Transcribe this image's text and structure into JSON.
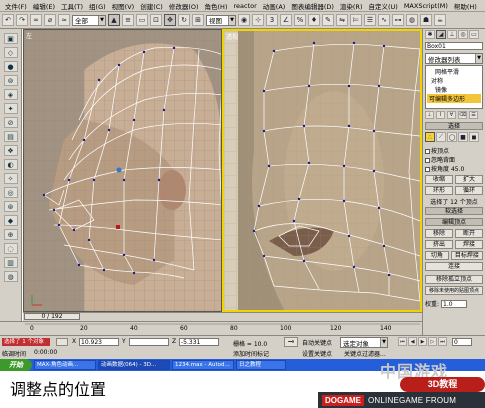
{
  "menubar": {
    "items": [
      "文件(F)",
      "编辑(E)",
      "工具(T)",
      "组(G)",
      "视图(V)",
      "创建(C)",
      "修改器(O)",
      "角色(H)",
      "reactor",
      "动画(A)",
      "图表编辑器(D)",
      "渲染(R)",
      "自定义(U)",
      "MAXScript(M)",
      "帮助(H)"
    ]
  },
  "toolbar": {
    "selection_filter": "全部",
    "view_combo": "视图"
  },
  "viewports": {
    "left_label": "左",
    "right_label": "透视"
  },
  "command_panel": {
    "object_name": "Box01",
    "modifier_list": "修改器列表",
    "stack": [
      "网格平滑",
      "对称",
      "镜像",
      "可编辑多边形"
    ],
    "select_rollout": "选择",
    "opt_by_vertex": "按顶点",
    "opt_ignore_back": "忽略背面",
    "opt_by_angle": "按角度",
    "angle_value": "45.0",
    "btn_shrink": "收缩",
    "btn_grow": "扩大",
    "btn_ring": "环形",
    "btn_loop": "循环",
    "status_selected": "选择了 12 个顶点",
    "soft_select_rollout": "软选择",
    "edit_vertices_rollout": "编辑顶点",
    "btn_remove": "移除",
    "btn_break": "断开",
    "btn_extrude": "挤出",
    "btn_weld": "焊接",
    "btn_chamfer": "切角",
    "btn_target_weld": "目标焊接",
    "btn_connect": "连接",
    "btn_remove_isolated": "移除孤立顶点",
    "btn_remove_unused_map": "移除未使用的贴图顶点",
    "weight_label": "权重:",
    "weight_value": "1.0"
  },
  "timeslider": {
    "label": "0 / 192"
  },
  "trackbar": {
    "ticks": [
      "0",
      "20",
      "40",
      "60",
      "80",
      "100",
      "120",
      "140"
    ]
  },
  "status": {
    "left_text": "选择了 1 个对象",
    "x_label": "X",
    "x_value": "10.923",
    "y_label": "Y",
    "y_value": "",
    "z_label": "Z",
    "z_value": "-5.331",
    "grid_label": "栅格 = 10.0",
    "autokey_label": "自动关键点",
    "autokey_mode": "选定对象",
    "setkey_label": "设置关键点",
    "keyfilter_label": "关键点过滤器...",
    "time_label": "添加时间标记",
    "prompt_text": "临调时间",
    "prompt_value": "0:00:00",
    "frame_value": "0"
  },
  "taskbar": {
    "start": "开始",
    "tasks": [
      "MAX-角色动画...",
      "动画数据(064) - 3D...",
      "1234.max - Autod...",
      "日之教程"
    ]
  },
  "caption": "调整点的位置",
  "watermark_cn": "中国游戏",
  "badge_3d": "3D教程",
  "dogame": {
    "logo": "DOGAME",
    "tagline": "ONLINEGAME FROUM"
  }
}
